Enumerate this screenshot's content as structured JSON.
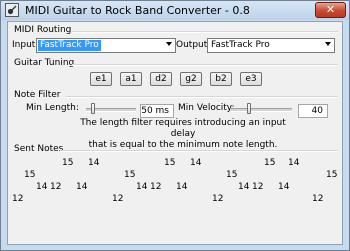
{
  "window": {
    "title": "MIDI Guitar to Rock Band Converter - 0.8",
    "close_glyph": "✕"
  },
  "routing": {
    "section_title": "MIDI Routing",
    "input_label": "Input:",
    "input_value": "FastTrack Pro",
    "output_label": "Output:",
    "output_value": "FastTrack Pro"
  },
  "tuning": {
    "section_title": "Guitar Tuning",
    "strings": [
      "e1",
      "a1",
      "d2",
      "g2",
      "b2",
      "e3"
    ]
  },
  "note_filter": {
    "section_title": "Note Filter",
    "min_length_label": "Min Length:",
    "min_length_value": "50 ms",
    "min_length_level": 0.1,
    "min_velocity_label": "Min Velocity:",
    "min_velocity_value": "40",
    "min_velocity_level": 0.3,
    "description_line1": "The length filter requires introducing an input delay",
    "description_line2": "that is equal to the minimum note length."
  },
  "sent_notes": {
    "section_title": "Sent Notes",
    "notes": [
      {
        "text": "15"
      },
      {
        "text": "14"
      },
      {
        "text": "15"
      },
      {
        "text": "14"
      },
      {
        "text": "15"
      },
      {
        "text": "14"
      },
      {
        "text": "15"
      },
      {
        "text": "14"
      },
      {
        "text": "15"
      },
      {
        "text": "15"
      },
      {
        "text": "15"
      },
      {
        "text": "15"
      },
      {
        "text": "14"
      },
      {
        "text": "12"
      },
      {
        "text": "14"
      },
      {
        "text": "14"
      },
      {
        "text": "12"
      },
      {
        "text": "14"
      },
      {
        "text": "14"
      },
      {
        "text": "12"
      },
      {
        "text": "14"
      },
      {
        "text": "14"
      },
      {
        "text": "12"
      },
      {
        "text": "14"
      },
      {
        "text": "12"
      },
      {
        "text": "12"
      },
      {
        "text": "12"
      },
      {
        "text": "12"
      }
    ]
  },
  "icons": {
    "app": "guitar-icon",
    "close": "close-icon"
  }
}
